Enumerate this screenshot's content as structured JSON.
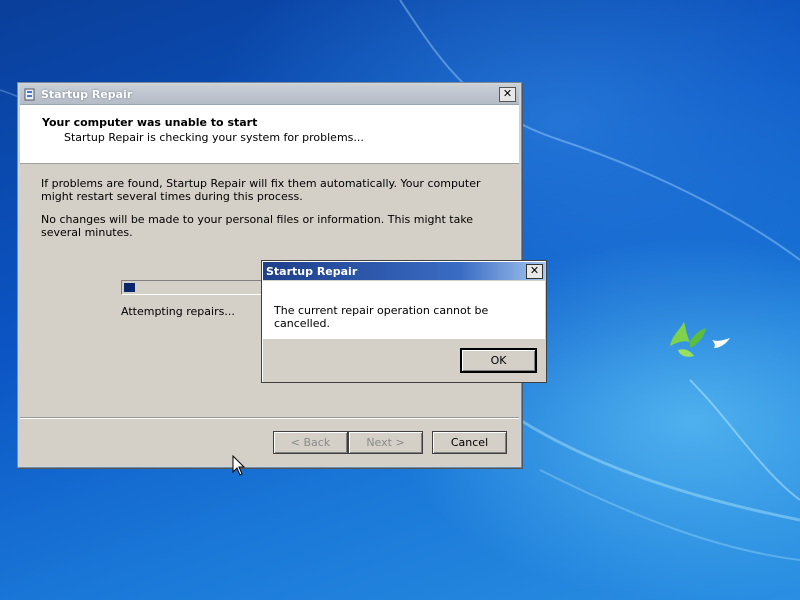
{
  "window": {
    "title": "Startup Repair",
    "header_title": "Your computer was unable to start",
    "header_subtitle": "Startup Repair is checking your system for problems...",
    "body_text_1": "If problems are found, Startup Repair will fix them automatically. Your computer might restart several times during this process.",
    "body_text_2": "No changes will be made to your personal files or information. This might take several minutes.",
    "progress_label": "Attempting repairs...",
    "progress_fraction": 0.08,
    "buttons": {
      "back": "< Back",
      "next": "Next >",
      "cancel": "Cancel"
    },
    "close_glyph": "✕"
  },
  "dialog": {
    "title": "Startup Repair",
    "message": "The current repair operation cannot be cancelled.",
    "ok_label": "OK",
    "close_glyph": "✕"
  },
  "icons": {
    "window_icon": "startup-repair-icon",
    "close": "close-icon",
    "cursor": "mouse-pointer-icon",
    "logo": "windows-bird-logo"
  },
  "colors": {
    "desktop_blue": "#0b55c4",
    "progress_fill": "#0a246a",
    "dialog_title_bar": "#1e3f8a",
    "window_face": "#d4d0c8"
  }
}
